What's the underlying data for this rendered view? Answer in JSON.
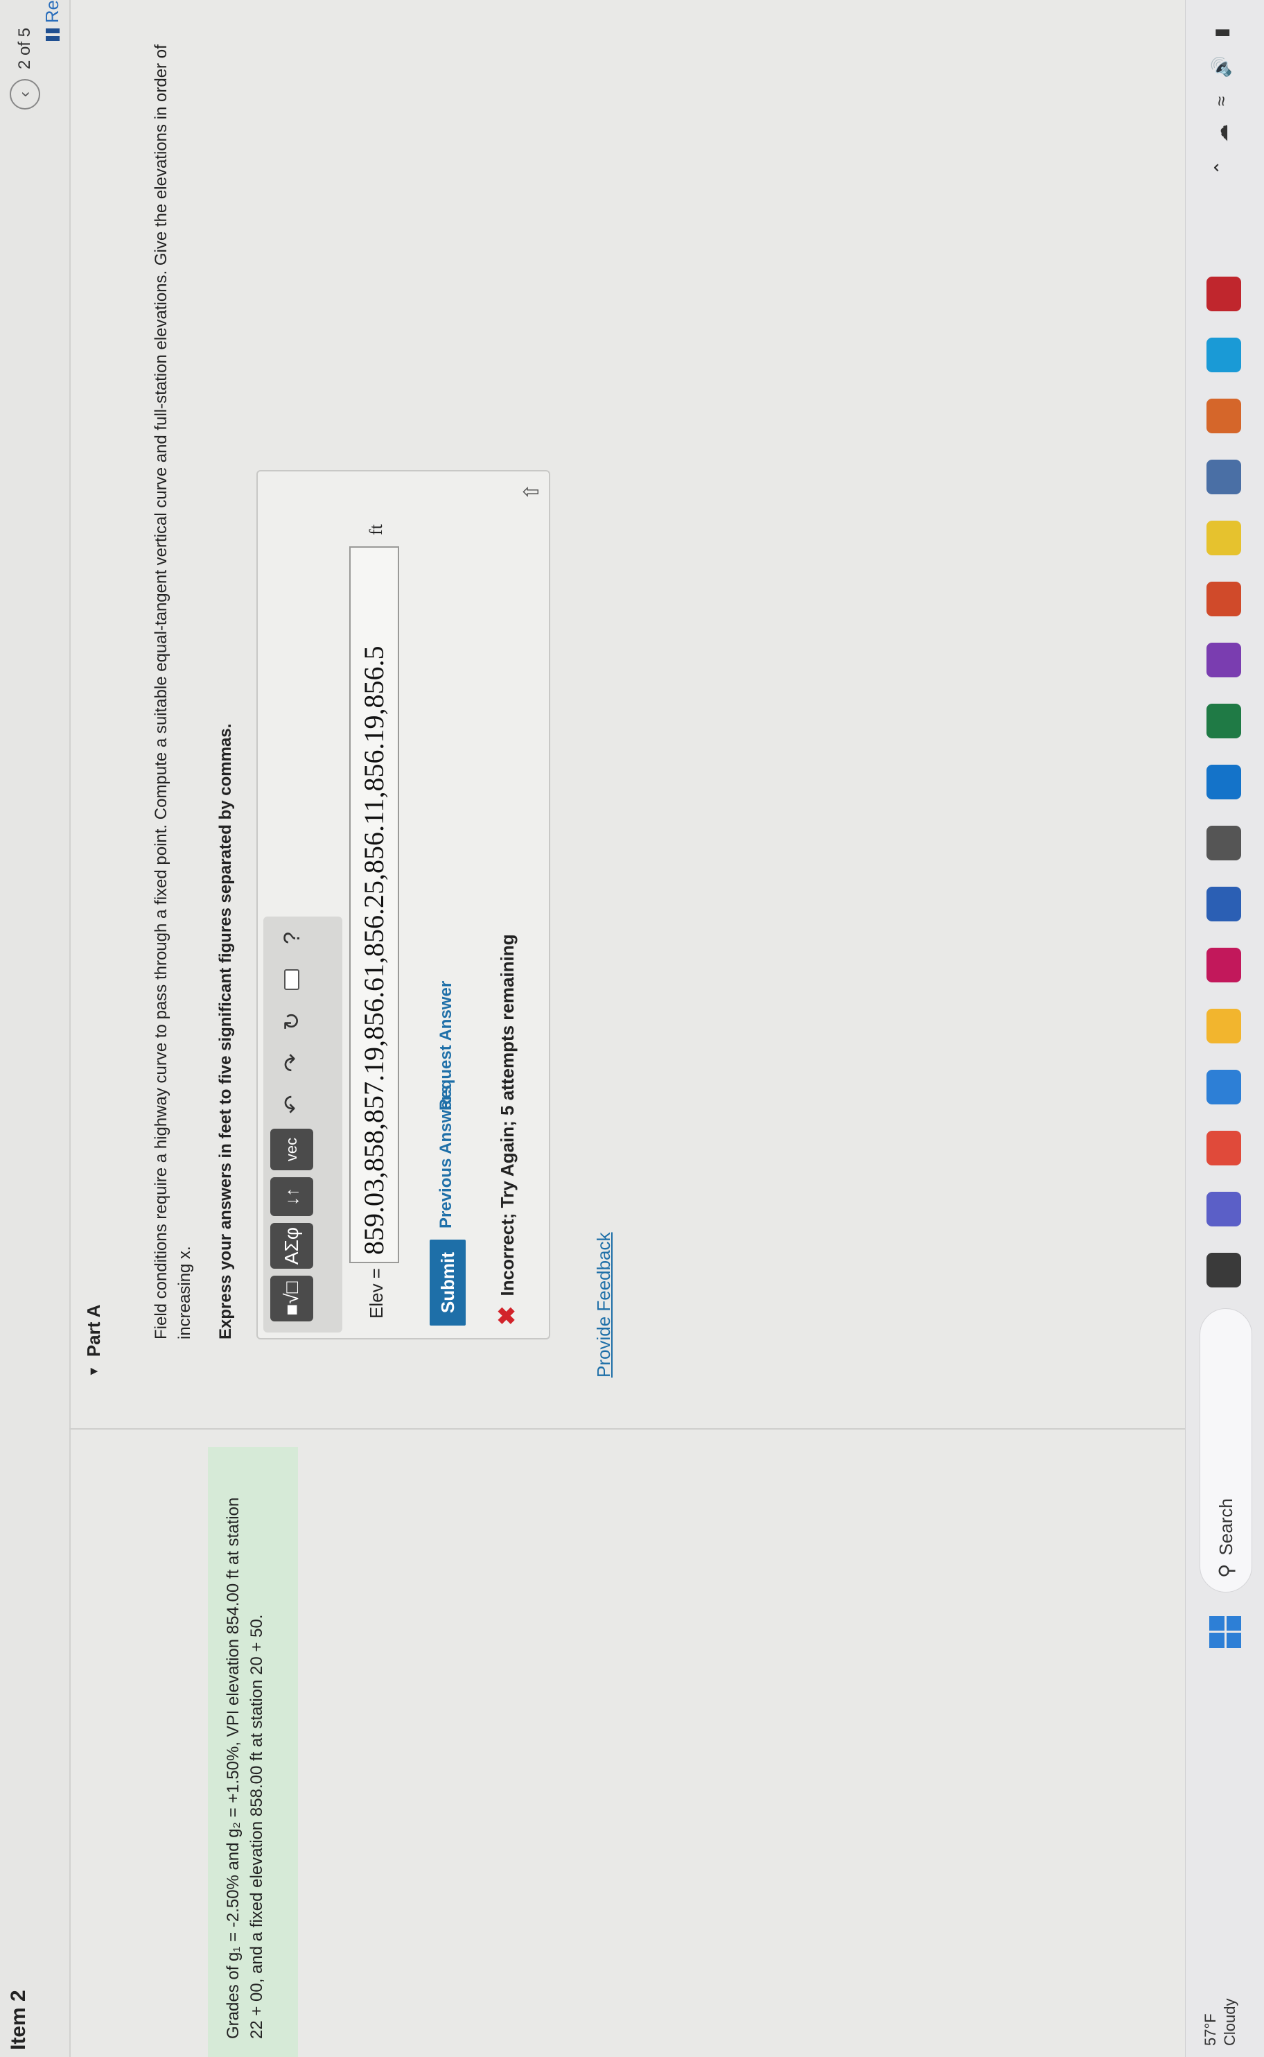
{
  "header": {
    "item_title": "Item 2",
    "pager_text": "2 of 5",
    "review_text": "Re"
  },
  "problem": {
    "line1": "Grades of g₁ = -2.50% and g₂ = +1.50%, VPI elevation 854.00 ft at station",
    "line2": "22 + 00, and a fixed elevation 858.00 ft at station 20 + 50."
  },
  "part": {
    "title": "Part A",
    "prompt": "Field conditions require a highway curve to pass through a fixed point. Compute a suitable equal-tangent vertical curve and full-station elevations. Give the elevations in order of increasing x.",
    "instruction": "Express your answers in feet to five significant figures separated by commas."
  },
  "toolbar": {
    "greek_label": "ΑΣφ",
    "arrows_label": "↓↑",
    "vec_label": "vec",
    "help_label": "?"
  },
  "answer": {
    "label": "Elev =",
    "value": "859.03,858,857.19,856.61,856.25,856.11,856.19,856.5",
    "unit": "ft"
  },
  "actions": {
    "submit": "Submit",
    "previous_answers": "Previous Answers",
    "request_answer": "Request Answer"
  },
  "feedback": {
    "text": "Incorrect; Try Again; 5 attempts remaining"
  },
  "links": {
    "provide_feedback": "Provide Feedback"
  },
  "taskbar": {
    "temperature": "57°F",
    "condition": "Cloudy",
    "search_label": "Search",
    "apps": [
      {
        "icon": "task-view-icon",
        "color": "#3a3a3a"
      },
      {
        "icon": "teams-icon",
        "color": "#5b5fc7"
      },
      {
        "icon": "chrome-icon",
        "color": "#e04a3a"
      },
      {
        "icon": "store-icon",
        "color": "#2d7fd6"
      },
      {
        "icon": "file-explorer-icon",
        "color": "#f2b52e"
      },
      {
        "icon": "snipping-tool-icon",
        "color": "#c2185b"
      },
      {
        "icon": "word-icon",
        "color": "#2b5fb4"
      },
      {
        "icon": "settings-icon",
        "color": "#555"
      },
      {
        "icon": "outlook-icon",
        "color": "#1473c9"
      },
      {
        "icon": "excel-icon",
        "color": "#1f7a45"
      },
      {
        "icon": "onenote-icon",
        "color": "#7a3db0"
      },
      {
        "icon": "powerpoint-icon",
        "color": "#d04a2a"
      },
      {
        "icon": "sticky-notes-icon",
        "color": "#e6c22e"
      },
      {
        "icon": "calculator-icon",
        "color": "#4a6fa5"
      },
      {
        "icon": "matlab-icon",
        "color": "#d5662a"
      },
      {
        "icon": "edge-icon",
        "color": "#1a9ad6"
      },
      {
        "icon": "acrobat-icon",
        "color": "#c0262d"
      }
    ]
  },
  "colors": {
    "accent": "#1e6fa8",
    "problem_bg": "#d6ead7",
    "error": "#d2232a"
  }
}
